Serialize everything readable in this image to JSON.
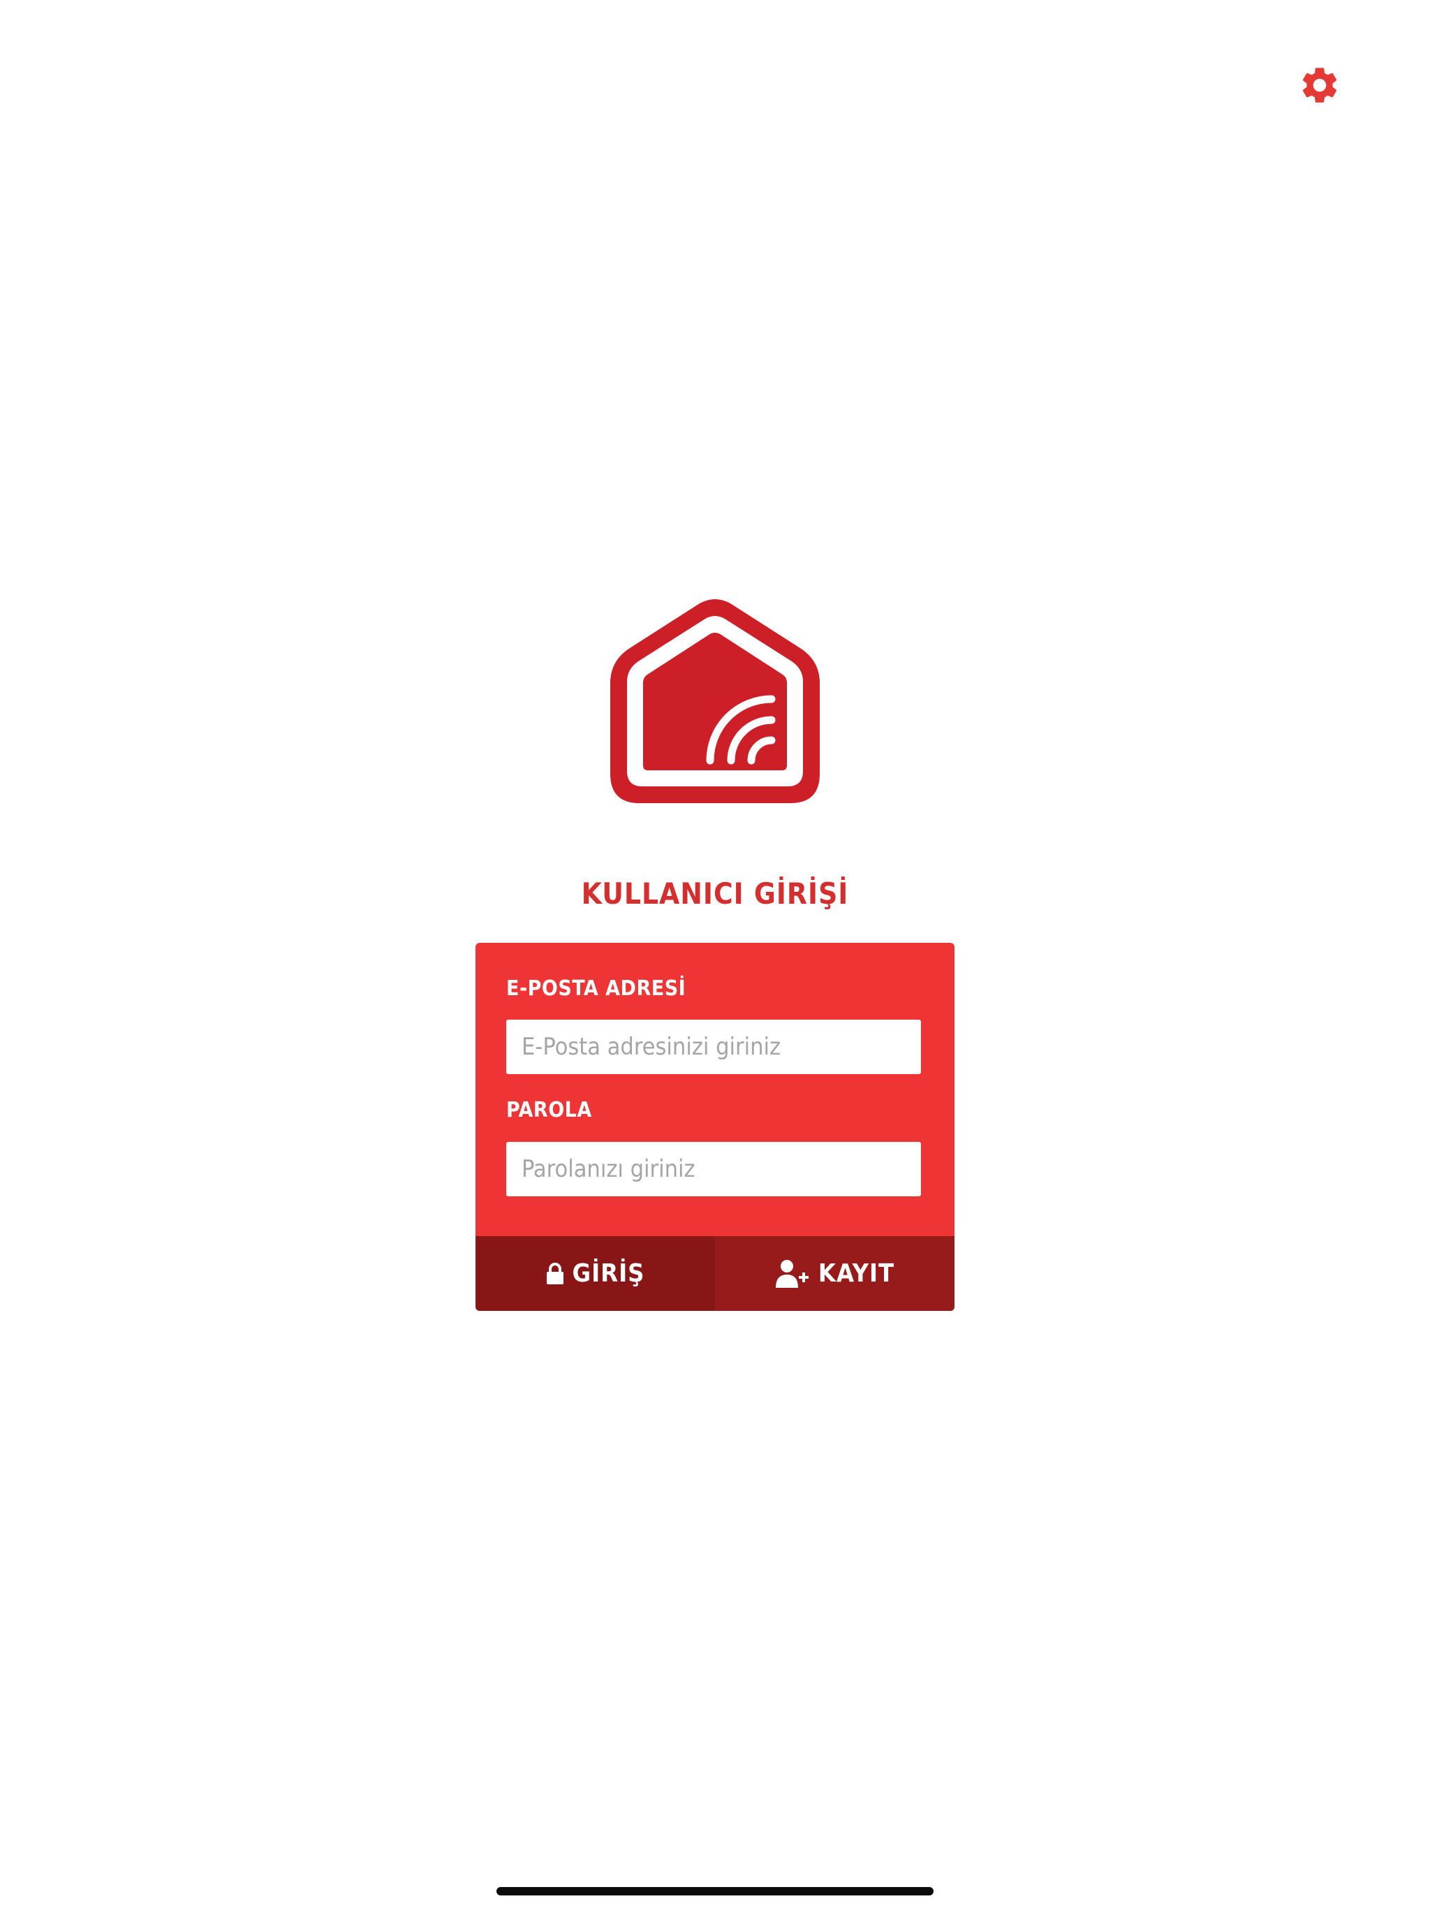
{
  "colors": {
    "brand_red": "#d32f2f",
    "card_red": "#ee3434",
    "login_button": "#891616",
    "register_button": "#971b1b",
    "background": "#ffffff"
  },
  "header": {
    "settings_icon": "gear-icon"
  },
  "logo": {
    "icon": "smart-home-wifi-icon"
  },
  "login": {
    "title": "KULLANICI GİRİŞİ",
    "email_label": "E-POSTA ADRESİ",
    "email_placeholder": "E-Posta adresinizi giriniz",
    "email_value": "",
    "password_label": "PAROLA",
    "password_placeholder": "Parolanızı giriniz",
    "password_value": "",
    "login_button_label": "GİRİŞ",
    "login_button_icon": "lock-icon",
    "register_button_label": "KAYIT",
    "register_button_icon": "add-user-icon"
  }
}
